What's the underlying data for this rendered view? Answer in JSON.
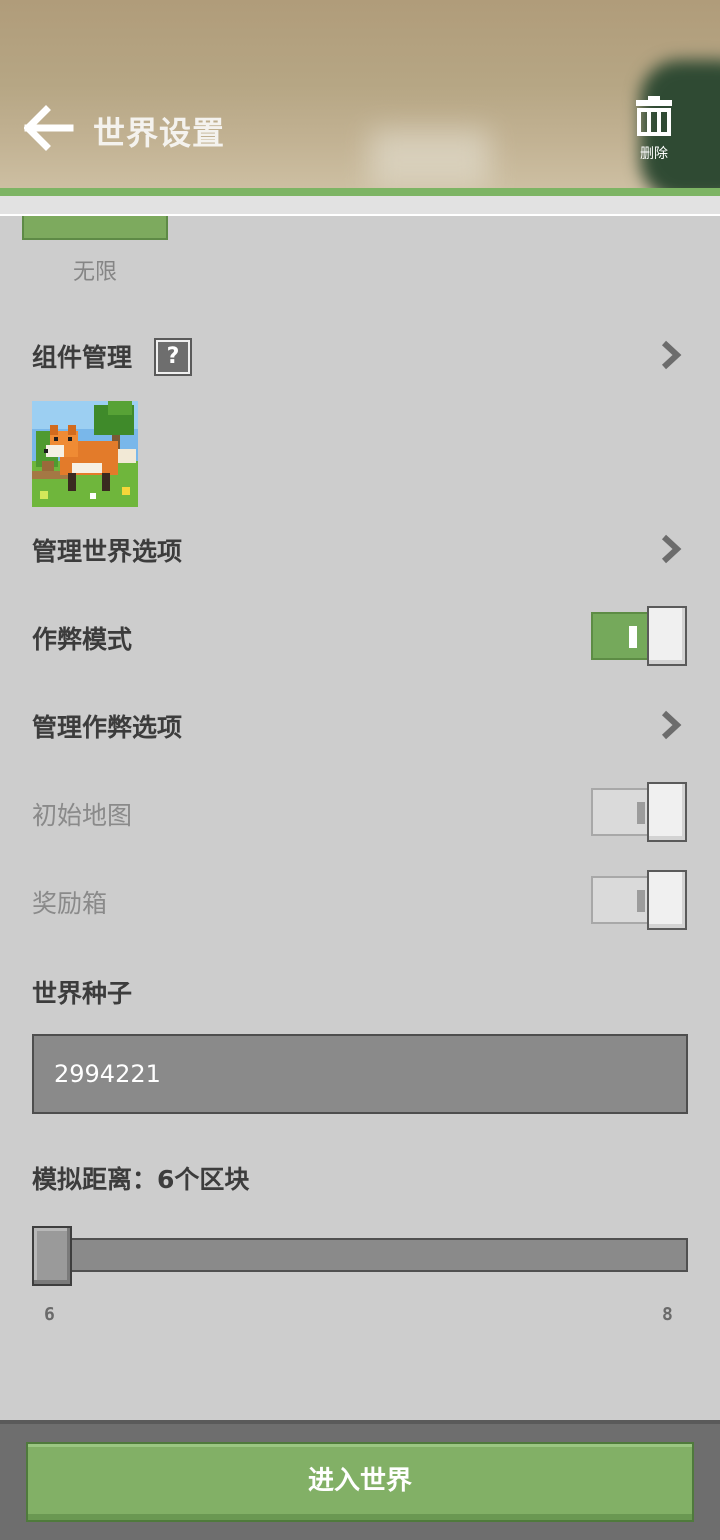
{
  "header": {
    "title": "世界设置",
    "back_icon": "arrow-left-icon",
    "delete_label": "删除",
    "delete_icon": "trash-icon"
  },
  "content": {
    "difficulty_caption": "无限",
    "components": {
      "label": "组件管理",
      "help_text": "?"
    },
    "manage_world_options": {
      "label": "管理世界选项"
    },
    "cheats": {
      "label": "作弊模式",
      "enabled": true
    },
    "manage_cheat_options": {
      "label": "管理作弊选项"
    },
    "starter_map": {
      "label": "初始地图",
      "enabled": false
    },
    "bonus_chest": {
      "label": "奖励箱",
      "enabled": false
    },
    "seed": {
      "label": "世界种子",
      "value": "2994221"
    },
    "simulation": {
      "label": "模拟距离：6个区块",
      "value": 6,
      "min": 6,
      "max": 8,
      "min_label": "6",
      "max_label": "8"
    }
  },
  "footer": {
    "enter_label": "进入世界"
  },
  "colors": {
    "accent_green": "#82b066",
    "header_line": "#7db464",
    "background": "#cdcdcd"
  }
}
